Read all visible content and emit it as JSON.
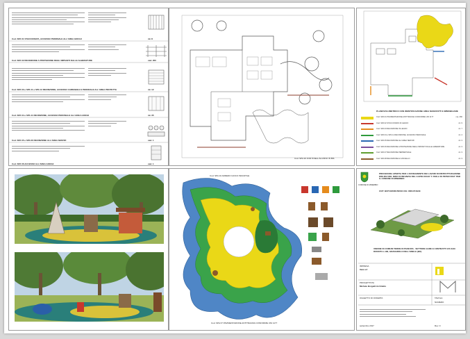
{
  "text_tables": {
    "rows": [
      {
        "code": "Cod. SPA 01 STACCIONATA, ACCESSO PEDONALE ALL'AREA GIOCHI",
        "count": "ml. 8"
      },
      {
        "code": "Cod. SPA 02 RECINZIONE A PROTEZIONE DEGLI IMPIANTI DALLE ALBERATURE",
        "count": "cad. 200"
      },
      {
        "code": "Cod. SPA 03 e SPA 11 e SPA 12 RECINZIONE, ACCESSO CARRABILE E PEDONALE ALL'AREA PROTETTA",
        "count": "ml. 12"
      },
      {
        "code": "Cod. SPA 04 e SPA 11 RECINZIONE, ACCESSO PEDONALE ALL'AREA GIOCHI",
        "count": "ml. 35"
      },
      {
        "code": "Cod. SPA 05 e SPA 06 RECINZIONE ALL'AREA SERVIZI",
        "count": "cad. 1"
      },
      {
        "code": "Cod. SPA 06 ACCESSO ALL'AREA GIOCHI",
        "count": "cad. 1"
      }
    ]
  },
  "site_plan": {
    "caption": "Cod. SPA 20 FOR 8 DELL'ALUNNO IN BIS"
  },
  "key_plan": {
    "caption": "PLANOVOLUMETRICO CON IDENTIFICAZIONE AREA MANUFATTI E IMMOBILIARE",
    "legend": [
      {
        "label": "Cod. SPA 01 PAVIMENTAZIONE ANTITRAUMA CONFORME UNI 1177",
        "color": "#ead817",
        "value": "mq. 460"
      },
      {
        "label": "Cod. SPA 02 STACCIONATA IN LEGNO",
        "color": "#c8372d",
        "value": "ml. 9"
      },
      {
        "label": "Cod. SPA 03 RECINZIONE IN LEGNO",
        "color": "#e58b1d",
        "value": "ml. 7"
      },
      {
        "label": "Cod. SPA 04 e SPA 11 RECINZIONE, ACCESSO PEDONALE",
        "color": "#2e9a3c",
        "value": "ml. 4"
      },
      {
        "label": "Cod. SPA 05 RECINZIONE ALL'AREA SERVIZI",
        "color": "#2967b3",
        "value": "ml. 3"
      },
      {
        "label": "Cod. SPA 06 RECINZIONE A PROTEZIONE DEGLI IMPIANTI DALLE ALBERATURE",
        "color": "#7a4c9a",
        "value": "ml. 3"
      },
      {
        "label": "Cod. SPA 07 RECINZIONE PERIMETRALE",
        "color": "#5f9e2f",
        "value": "ml. 3"
      },
      {
        "label": "Cod. SPA 08 RECINZIONE E CANCELLO",
        "color": "#8b5a2b",
        "value": "ml. 3"
      }
    ]
  },
  "playground_plan": {
    "title": "Cod. SPA 10 ARREDO GIOCO INFANTILE",
    "caption": "Cod. SPA 07 PAVIMENTAZIONE ANTITRAUMA CONFORME UNI 1177"
  },
  "title_block": {
    "municipality": "COMUNE DI MINERBIO",
    "heading": "PROCEDURA APERTA PER L'AFFIDAMENTO DEI LAVORI DI RISTRUTTURAZIONE EDILIZIA DEL NIDO DI INFANZIA DEL CAPOLUOGO \"L'ISOLA DI PETER PAN\" PER IL COMUNE DI MINERBIO",
    "cup": "CUP: B67C18000150004 CIG: 80614743A8",
    "client": "UNIONE DI COMUNI TERRE DI PIANURA - SETTORE GARE E CONTRATTI VIA SAN DONATO n.199, GRANAROLO DELL'EMILIA (BO)",
    "company_label": "IMPRESA",
    "company": "Itaca srl",
    "designer_label": "PROGETTISTA",
    "designer": "Michele Borgatti Architetto",
    "subject_label": "OGGETTO DI OFFERTA",
    "table_label": "TAVOLA",
    "number_label": "NUMERO",
    "date": "settembre 2017",
    "revision": "Rev. 0"
  }
}
